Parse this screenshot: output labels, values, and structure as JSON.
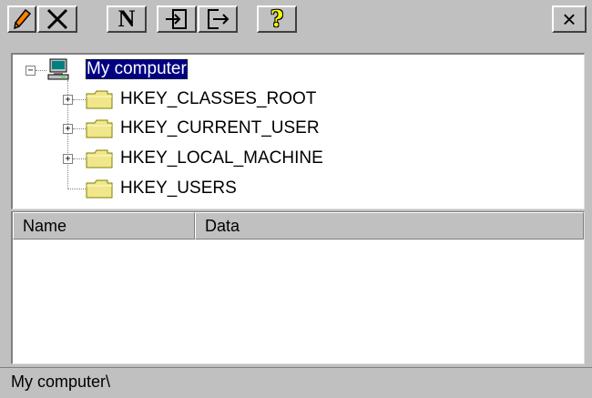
{
  "toolbar": {
    "buttons": [
      {
        "name": "edit-button",
        "icon": "pencil-icon"
      },
      {
        "name": "delete-button",
        "icon": "x-icon"
      },
      {
        "name": "new-button",
        "icon": "n-icon",
        "label": "N"
      },
      {
        "name": "import-button",
        "icon": "import-icon"
      },
      {
        "name": "export-button",
        "icon": "export-icon"
      },
      {
        "name": "help-button",
        "icon": "question-icon",
        "label": "?"
      }
    ],
    "close_label": "×"
  },
  "tree": {
    "root": {
      "label": "My computer",
      "expanded": true,
      "selected": true,
      "icon": "computer-icon"
    },
    "children": [
      {
        "label": "HKEY_CLASSES_ROOT",
        "expandable": true,
        "icon": "folder-icon"
      },
      {
        "label": "HKEY_CURRENT_USER",
        "expandable": true,
        "icon": "folder-icon"
      },
      {
        "label": "HKEY_LOCAL_MACHINE",
        "expandable": true,
        "icon": "folder-icon"
      },
      {
        "label": "HKEY_USERS",
        "expandable": false,
        "icon": "folder-icon"
      }
    ],
    "expander_minus": "−",
    "expander_plus": "+"
  },
  "list": {
    "columns": [
      "Name",
      "Data"
    ],
    "rows": []
  },
  "status": {
    "path": "My computer\\"
  },
  "colors": {
    "face": "#c0c0c0",
    "selection": "#000080",
    "folder": "#f0e68c"
  }
}
